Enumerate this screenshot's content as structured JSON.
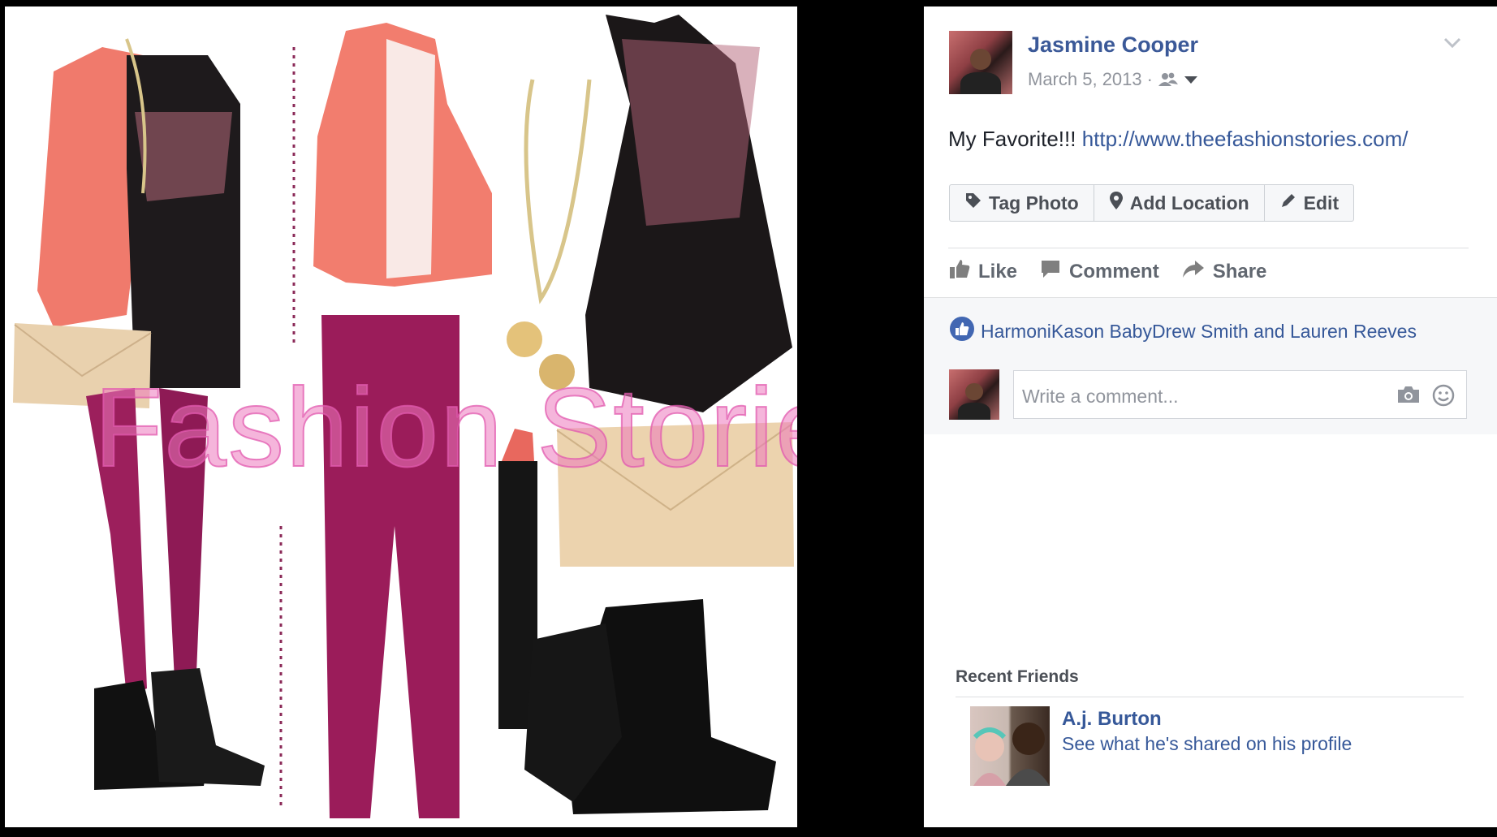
{
  "post": {
    "author": "Jasmine Cooper",
    "date": "March 5, 2013",
    "separator": "·",
    "text": "My Favorite!!!",
    "link": "http://www.theefashionstories.com/"
  },
  "photo": {
    "watermark": "Fashion Stories"
  },
  "photo_actions": {
    "tag": "Tag Photo",
    "location": "Add Location",
    "edit": "Edit"
  },
  "social": {
    "like": "Like",
    "comment": "Comment",
    "share": "Share"
  },
  "likes_text": "HarmoniKason BabyDrew Smith and Lauren Reeves",
  "comment_input": {
    "placeholder": "Write a comment..."
  },
  "recent_friends": {
    "title": "Recent Friends",
    "items": [
      {
        "name": "A.j. Burton",
        "subtitle": "See what he's shared on his profile"
      }
    ]
  },
  "colors": {
    "link_blue": "#365899",
    "name_blue": "#3b5998",
    "like_badge": "#4267b2",
    "muted_gray": "#90949c",
    "panel_gray": "#f6f7f9"
  },
  "icons": [
    "audience-friends-icon",
    "dropdown-caret-icon",
    "chevron-down-icon",
    "tag-icon",
    "location-pin-icon",
    "pencil-icon",
    "thumbs-up-icon",
    "comment-icon",
    "share-arrow-icon",
    "like-badge-icon",
    "camera-icon",
    "smiley-icon"
  ]
}
